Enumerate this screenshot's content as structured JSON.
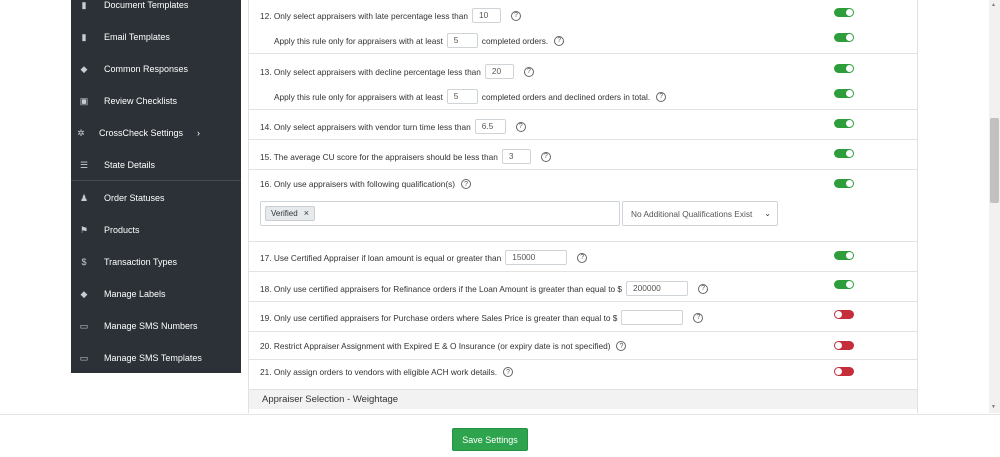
{
  "sidebar": {
    "items": [
      {
        "label": "Document Templates",
        "icon": "document-icon"
      },
      {
        "label": "Email Templates",
        "icon": "document-icon"
      },
      {
        "label": "Common Responses",
        "icon": "tag-icon"
      },
      {
        "label": "Review Checklists",
        "icon": "clipboard-icon"
      },
      {
        "label": "CrossCheck Settings",
        "icon": "gear-icon",
        "has_submenu": true
      },
      {
        "label": "State Details",
        "icon": "list-icon"
      },
      {
        "label": "Order Statuses",
        "icon": "user-status-icon"
      },
      {
        "label": "Products",
        "icon": "flag-icon"
      },
      {
        "label": "Transaction Types",
        "icon": "money-icon"
      },
      {
        "label": "Manage Labels",
        "icon": "tag-icon"
      },
      {
        "label": "Manage SMS Numbers",
        "icon": "sms-icon"
      },
      {
        "label": "Manage SMS Templates",
        "icon": "sms-icon"
      }
    ],
    "submenu_glyph": "›"
  },
  "rules": {
    "r12": {
      "text": "12. Only select appraisers with late percentage less than",
      "value": "10",
      "toggle": "on"
    },
    "r12b": {
      "text_before": "Apply this rule only for appraisers with at least",
      "value": "5",
      "text_after": "completed orders.",
      "toggle": "on"
    },
    "r13": {
      "text": "13. Only select appraisers with decline percentage less than",
      "value": "20",
      "toggle": "on"
    },
    "r13b": {
      "text_before": "Apply this rule only for appraisers with at least",
      "value": "5",
      "text_after": "completed orders and declined orders in total.",
      "toggle": "on"
    },
    "r14": {
      "text": "14. Only select appraisers with vendor turn time less than",
      "value": "6.5",
      "toggle": "on"
    },
    "r15": {
      "text": "15. The average CU score for the appraisers should be less than",
      "value": "3",
      "toggle": "on"
    },
    "r16": {
      "text": "16. Only use appraisers with following qualification(s)",
      "tag": "Verified",
      "tag_remove": "×",
      "select_value": "No Additional Qualifications Exist",
      "toggle": "on"
    },
    "r17": {
      "text": "17. Use Certified Appraiser if loan amount is equal or greater than",
      "value": "15000",
      "toggle": "on"
    },
    "r18": {
      "text": "18. Only use certified appraisers for Refinance orders if the Loan Amount is greater than equal to $",
      "value": "200000",
      "toggle": "on"
    },
    "r19": {
      "text": "19. Only use certified appraisers for Purchase orders where Sales Price is greater than equal to $",
      "value": "",
      "toggle": "off"
    },
    "r20": {
      "text": "20. Restrict Appraiser Assignment with Expired E & O Insurance (or expiry date is not specified)",
      "toggle": "off"
    },
    "r21": {
      "text": "21. Only assign orders to vendors with eligible ACH work details.",
      "toggle": "off"
    }
  },
  "help_glyph": "?",
  "section": {
    "title": "Appraiser Selection - Weightage"
  },
  "footer": {
    "save_label": "Save Settings"
  },
  "colors": {
    "sidebar_bg": "#2b3136",
    "toggle_on": "#2e9e3c",
    "toggle_off": "#c62d3a",
    "save_button": "#2ea44f"
  }
}
